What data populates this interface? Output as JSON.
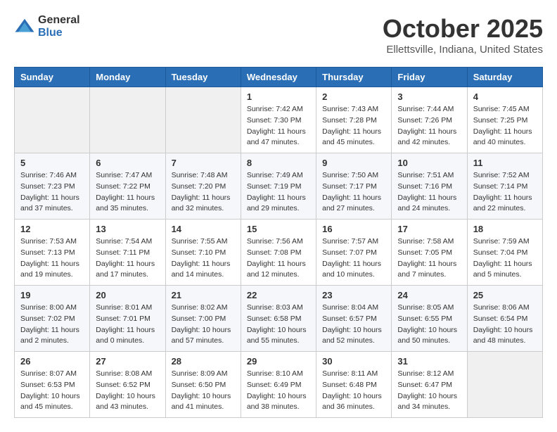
{
  "header": {
    "logo_general": "General",
    "logo_blue": "Blue",
    "month": "October 2025",
    "location": "Ellettsville, Indiana, United States"
  },
  "weekdays": [
    "Sunday",
    "Monday",
    "Tuesday",
    "Wednesday",
    "Thursday",
    "Friday",
    "Saturday"
  ],
  "weeks": [
    [
      {
        "day": "",
        "info": ""
      },
      {
        "day": "",
        "info": ""
      },
      {
        "day": "",
        "info": ""
      },
      {
        "day": "1",
        "info": "Sunrise: 7:42 AM\nSunset: 7:30 PM\nDaylight: 11 hours and 47 minutes."
      },
      {
        "day": "2",
        "info": "Sunrise: 7:43 AM\nSunset: 7:28 PM\nDaylight: 11 hours and 45 minutes."
      },
      {
        "day": "3",
        "info": "Sunrise: 7:44 AM\nSunset: 7:26 PM\nDaylight: 11 hours and 42 minutes."
      },
      {
        "day": "4",
        "info": "Sunrise: 7:45 AM\nSunset: 7:25 PM\nDaylight: 11 hours and 40 minutes."
      }
    ],
    [
      {
        "day": "5",
        "info": "Sunrise: 7:46 AM\nSunset: 7:23 PM\nDaylight: 11 hours and 37 minutes."
      },
      {
        "day": "6",
        "info": "Sunrise: 7:47 AM\nSunset: 7:22 PM\nDaylight: 11 hours and 35 minutes."
      },
      {
        "day": "7",
        "info": "Sunrise: 7:48 AM\nSunset: 7:20 PM\nDaylight: 11 hours and 32 minutes."
      },
      {
        "day": "8",
        "info": "Sunrise: 7:49 AM\nSunset: 7:19 PM\nDaylight: 11 hours and 29 minutes."
      },
      {
        "day": "9",
        "info": "Sunrise: 7:50 AM\nSunset: 7:17 PM\nDaylight: 11 hours and 27 minutes."
      },
      {
        "day": "10",
        "info": "Sunrise: 7:51 AM\nSunset: 7:16 PM\nDaylight: 11 hours and 24 minutes."
      },
      {
        "day": "11",
        "info": "Sunrise: 7:52 AM\nSunset: 7:14 PM\nDaylight: 11 hours and 22 minutes."
      }
    ],
    [
      {
        "day": "12",
        "info": "Sunrise: 7:53 AM\nSunset: 7:13 PM\nDaylight: 11 hours and 19 minutes."
      },
      {
        "day": "13",
        "info": "Sunrise: 7:54 AM\nSunset: 7:11 PM\nDaylight: 11 hours and 17 minutes."
      },
      {
        "day": "14",
        "info": "Sunrise: 7:55 AM\nSunset: 7:10 PM\nDaylight: 11 hours and 14 minutes."
      },
      {
        "day": "15",
        "info": "Sunrise: 7:56 AM\nSunset: 7:08 PM\nDaylight: 11 hours and 12 minutes."
      },
      {
        "day": "16",
        "info": "Sunrise: 7:57 AM\nSunset: 7:07 PM\nDaylight: 11 hours and 10 minutes."
      },
      {
        "day": "17",
        "info": "Sunrise: 7:58 AM\nSunset: 7:05 PM\nDaylight: 11 hours and 7 minutes."
      },
      {
        "day": "18",
        "info": "Sunrise: 7:59 AM\nSunset: 7:04 PM\nDaylight: 11 hours and 5 minutes."
      }
    ],
    [
      {
        "day": "19",
        "info": "Sunrise: 8:00 AM\nSunset: 7:02 PM\nDaylight: 11 hours and 2 minutes."
      },
      {
        "day": "20",
        "info": "Sunrise: 8:01 AM\nSunset: 7:01 PM\nDaylight: 11 hours and 0 minutes."
      },
      {
        "day": "21",
        "info": "Sunrise: 8:02 AM\nSunset: 7:00 PM\nDaylight: 10 hours and 57 minutes."
      },
      {
        "day": "22",
        "info": "Sunrise: 8:03 AM\nSunset: 6:58 PM\nDaylight: 10 hours and 55 minutes."
      },
      {
        "day": "23",
        "info": "Sunrise: 8:04 AM\nSunset: 6:57 PM\nDaylight: 10 hours and 52 minutes."
      },
      {
        "day": "24",
        "info": "Sunrise: 8:05 AM\nSunset: 6:55 PM\nDaylight: 10 hours and 50 minutes."
      },
      {
        "day": "25",
        "info": "Sunrise: 8:06 AM\nSunset: 6:54 PM\nDaylight: 10 hours and 48 minutes."
      }
    ],
    [
      {
        "day": "26",
        "info": "Sunrise: 8:07 AM\nSunset: 6:53 PM\nDaylight: 10 hours and 45 minutes."
      },
      {
        "day": "27",
        "info": "Sunrise: 8:08 AM\nSunset: 6:52 PM\nDaylight: 10 hours and 43 minutes."
      },
      {
        "day": "28",
        "info": "Sunrise: 8:09 AM\nSunset: 6:50 PM\nDaylight: 10 hours and 41 minutes."
      },
      {
        "day": "29",
        "info": "Sunrise: 8:10 AM\nSunset: 6:49 PM\nDaylight: 10 hours and 38 minutes."
      },
      {
        "day": "30",
        "info": "Sunrise: 8:11 AM\nSunset: 6:48 PM\nDaylight: 10 hours and 36 minutes."
      },
      {
        "day": "31",
        "info": "Sunrise: 8:12 AM\nSunset: 6:47 PM\nDaylight: 10 hours and 34 minutes."
      },
      {
        "day": "",
        "info": ""
      }
    ]
  ]
}
